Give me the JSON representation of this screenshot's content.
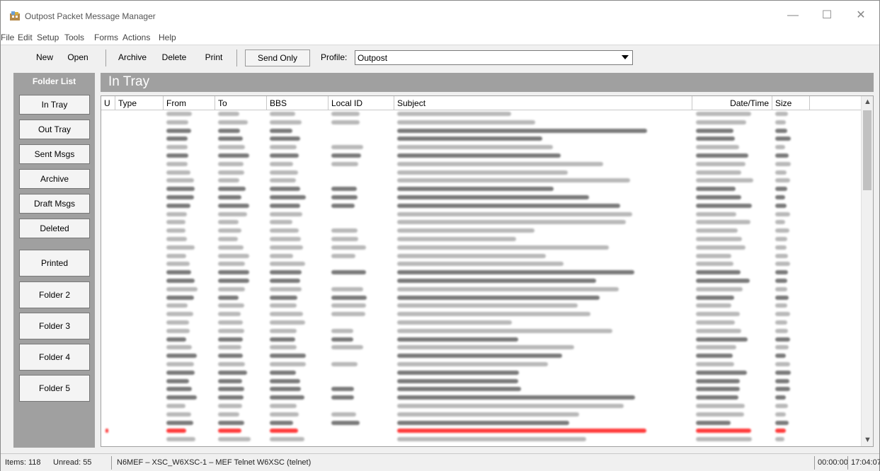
{
  "app": {
    "title": "Outpost Packet Message Manager",
    "icon": "outpost-app-icon",
    "controls": {
      "minimize": "—",
      "maximize": "☐",
      "close": "✕"
    }
  },
  "menu": [
    {
      "label": "File"
    },
    {
      "label": "Edit"
    },
    {
      "label": "Setup"
    },
    {
      "label": "Tools"
    },
    {
      "label": "Forms"
    },
    {
      "label": "Actions"
    },
    {
      "label": "Help"
    }
  ],
  "toolbar": {
    "new_label": "New",
    "open_label": "Open",
    "archive_label": "Archive",
    "delete_label": "Delete",
    "print_label": "Print",
    "send_only_label": "Send Only",
    "profile_label": "Profile:",
    "profile_value": "Outpost"
  },
  "sidebar": {
    "header": "Folder List",
    "folders": [
      {
        "label": "In Tray"
      },
      {
        "label": "Out Tray"
      },
      {
        "label": "Sent Msgs"
      },
      {
        "label": "Archive"
      },
      {
        "label": "Draft Msgs"
      },
      {
        "label": "Deleted"
      },
      {
        "label": "Printed"
      },
      {
        "label": "Folder 2"
      },
      {
        "label": "Folder 3"
      },
      {
        "label": "Folder 4"
      },
      {
        "label": "Folder 5"
      }
    ]
  },
  "main": {
    "title": "In Tray",
    "columns": [
      {
        "label": "U"
      },
      {
        "label": "Type"
      },
      {
        "label": "From"
      },
      {
        "label": "To"
      },
      {
        "label": "BBS"
      },
      {
        "label": "Local ID"
      },
      {
        "label": "Subject"
      },
      {
        "label": "Date/Time"
      },
      {
        "label": "Size"
      }
    ],
    "rows_note_blurred": true,
    "row_count_visible": 40,
    "highlight_color": "#ff3b3b"
  },
  "status": {
    "items": "Items: 118",
    "unread": "Unread: 55",
    "connection": "N6MEF – XSC_W6XSC-1 – MEF Telnet W6XSC (telnet)",
    "elapsed": "00:00:00",
    "clock": "17:04:07"
  },
  "colors": {
    "panel_gray": "#a0a0a0",
    "window_bg": "#f0f0f0",
    "unread_red": "#ff3b3b"
  }
}
